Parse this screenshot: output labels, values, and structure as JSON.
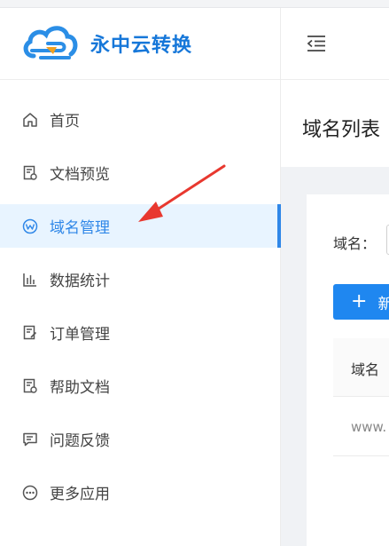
{
  "brand": {
    "name": "永中云转换",
    "logo_icon": "cloud-link-icon"
  },
  "menu": {
    "items": [
      {
        "label": "首页",
        "icon": "home-icon"
      },
      {
        "label": "文档预览",
        "icon": "document-preview-icon"
      },
      {
        "label": "域名管理",
        "icon": "domain-icon",
        "active": true
      },
      {
        "label": "数据统计",
        "icon": "bar-chart-icon"
      },
      {
        "label": "订单管理",
        "icon": "order-edit-icon"
      },
      {
        "label": "帮助文档",
        "icon": "help-document-icon"
      },
      {
        "label": "问题反馈",
        "icon": "feedback-icon"
      },
      {
        "label": "更多应用",
        "icon": "more-apps-icon"
      }
    ]
  },
  "header": {
    "collapse_icon": "menu-collapse-icon"
  },
  "page": {
    "title": "域名列表"
  },
  "filter": {
    "label": "域名："
  },
  "toolbar": {
    "new_label": "新"
  },
  "table": {
    "columns": [
      "域名"
    ],
    "rows": [
      [
        "www."
      ]
    ]
  },
  "colors": {
    "accent": "#2f87e8",
    "brand": "#1677d9",
    "annotation_arrow": "#e8382f"
  }
}
